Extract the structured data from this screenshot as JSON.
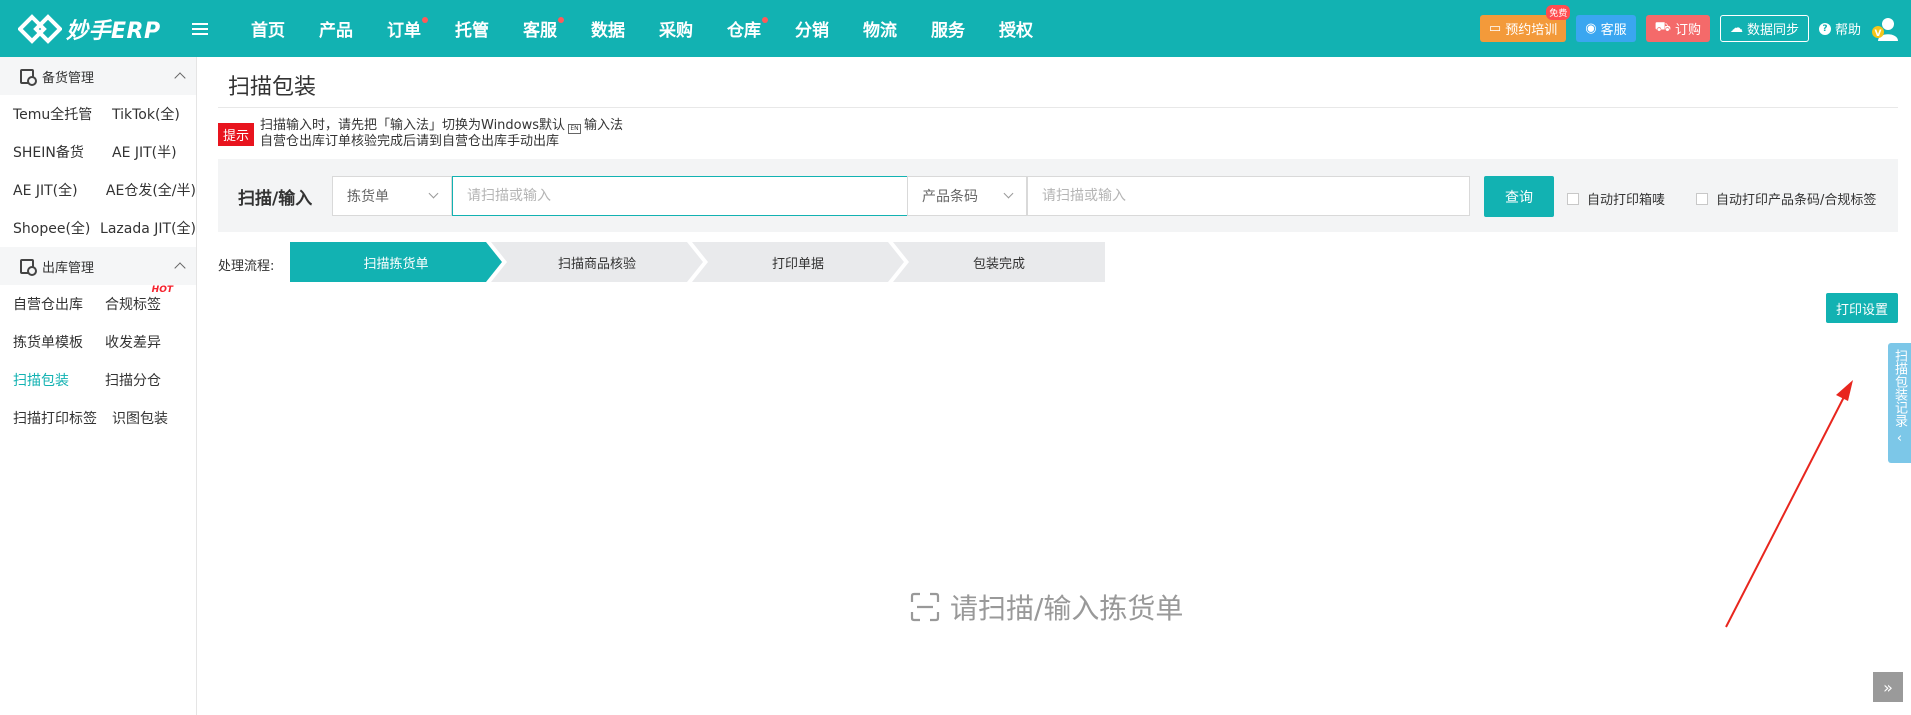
{
  "header": {
    "brand": "妙手ERP",
    "nav": [
      {
        "label": "首页",
        "dot": false
      },
      {
        "label": "产品",
        "dot": false
      },
      {
        "label": "订单",
        "dot": true
      },
      {
        "label": "托管",
        "dot": false
      },
      {
        "label": "客服",
        "dot": true
      },
      {
        "label": "数据",
        "dot": false
      },
      {
        "label": "采购",
        "dot": false
      },
      {
        "label": "仓库",
        "dot": true
      },
      {
        "label": "分销",
        "dot": false
      },
      {
        "label": "物流",
        "dot": false
      },
      {
        "label": "服务",
        "dot": false
      },
      {
        "label": "授权",
        "dot": false
      }
    ],
    "train_label": "预约培训",
    "free_badge": "免费",
    "service_label": "客服",
    "order_label": "订购",
    "sync_label": "数据同步",
    "help_label": "帮助",
    "accent": "#12b2b2"
  },
  "sidebar": {
    "groups": [
      {
        "title": "备货管理",
        "rows": [
          [
            "Temu全托管",
            "TikTok(全)"
          ],
          [
            "SHEIN备货",
            "AE JIT(半)"
          ],
          [
            "AE JIT(全)",
            "AE仓发(全/半)"
          ],
          [
            "Shopee(全)",
            "Lazada JIT(全)"
          ]
        ]
      },
      {
        "title": "出库管理",
        "rows": [
          [
            "自营仓出库",
            "合规标签"
          ],
          [
            "拣货单模板",
            "收发差异"
          ],
          [
            "扫描包装",
            "扫描分仓"
          ],
          [
            "扫描打印标签",
            "识图包装"
          ]
        ]
      }
    ],
    "hot_label": "HOT",
    "active_item": "扫描包装"
  },
  "main": {
    "title": "扫描包装",
    "tip_badge": "提示",
    "tip_line1_a": "扫描输入时，请先把「输入法」切换为Windows默认",
    "tip_line1_b": "输入法",
    "tip_line2": "自营仓出库订单核验完成后请到自营仓出库手动出库",
    "scan_label": "扫描/输入",
    "select1_value": "拣货单",
    "input1_placeholder": "请扫描或输入",
    "select2_value": "产品条码",
    "input2_placeholder": "请扫描或输入",
    "query_label": "查询",
    "chk1_label": "自动打印箱唛",
    "chk2_label": "自动打印产品条码/合规标签",
    "process_label": "处理流程:",
    "steps": [
      "扫描拣货单",
      "扫描商品核验",
      "打印单据",
      "包装完成"
    ],
    "print_settings_label": "打印设置",
    "empty_hint": "请扫描/输入拣货单",
    "side_tab_label": "扫描包装记录"
  }
}
